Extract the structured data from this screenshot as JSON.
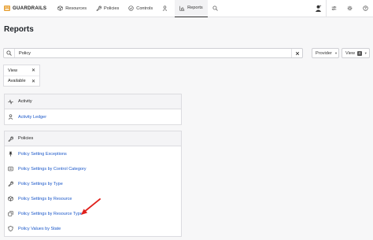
{
  "brand": {
    "name": "GUARDRAILS",
    "logo_color": "#e8a33a"
  },
  "nav": {
    "tabs": [
      {
        "label": "Resources",
        "icon": "cube-icon"
      },
      {
        "label": "Policies",
        "icon": "wrench-icon"
      },
      {
        "label": "Controls",
        "icon": "check-circle-icon"
      },
      {
        "label": "",
        "icon": "bear-icon"
      },
      {
        "label": "Reports",
        "icon": "chart-icon"
      }
    ],
    "active_tab": "Reports",
    "right_icons": [
      "user-icon",
      "settings-sliders-icon",
      "gear-icon",
      "help-icon"
    ]
  },
  "page": {
    "title": "Reports"
  },
  "search": {
    "value": "Policy",
    "placeholder": ""
  },
  "toolbar": {
    "provider_label": "Provider",
    "view_label": "View",
    "view_count": "4"
  },
  "filters": [
    {
      "label": "View"
    },
    {
      "label": "Available"
    }
  ],
  "groups": [
    {
      "label": "Activity",
      "icon": "activity-icon",
      "items": [
        {
          "label": "Activity Ledger",
          "icon": "person-icon"
        }
      ]
    },
    {
      "label": "Policies",
      "icon": "wrench-icon",
      "items": [
        {
          "label": "Policy Setting Exceptions",
          "icon": "pin-icon"
        },
        {
          "label": "Policy Settings by Control Category",
          "icon": "list-box-icon"
        },
        {
          "label": "Policy Settings by Type",
          "icon": "wrench-icon"
        },
        {
          "label": "Policy Settings by Resource",
          "icon": "cube-icon"
        },
        {
          "label": "Policy Settings by Resource Type",
          "icon": "stack-icon"
        },
        {
          "label": "Policy Values by State",
          "icon": "shield-icon"
        }
      ]
    }
  ],
  "colors": {
    "link": "#1a57c9",
    "annotation_arrow": "#e0201b"
  }
}
